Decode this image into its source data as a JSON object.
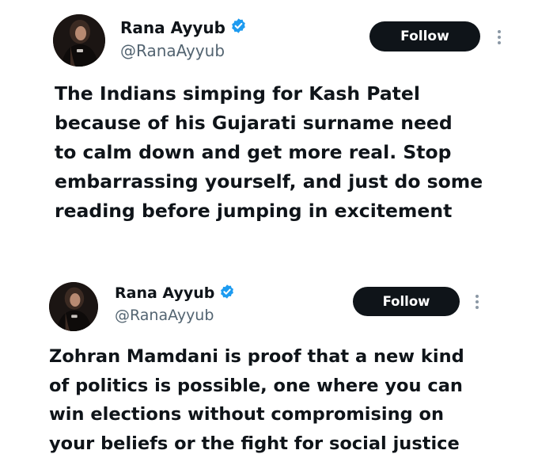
{
  "tweets": [
    {
      "author": {
        "name": "Rana Ayyub",
        "handle": "@RanaAyyub",
        "verified": true
      },
      "follow_label": "Follow",
      "text_lines": [
        "The Indians simping for Kash Patel",
        "because of his Gujarati surname need",
        "to calm down and get more real. Stop",
        "embarrassing yourself, and just do some",
        "reading before jumping in excitement"
      ]
    },
    {
      "author": {
        "name": "Rana Ayyub",
        "handle": "@RanaAyyub",
        "verified": true
      },
      "follow_label": "Follow",
      "text_lines": [
        "Zohran Mamdani is proof that a new kind",
        "of politics is possible, one where you can",
        "win elections without compromising on",
        "your beliefs or the fight for social justice"
      ]
    }
  ],
  "colors": {
    "text": "#0f1419",
    "secondary": "#536471",
    "verified_blue": "#1d9bf0",
    "follow_bg": "#0f1419",
    "follow_text": "#ffffff"
  },
  "icons": {
    "verified": "verified-badge-icon",
    "more": "more-options-icon",
    "avatar": "profile-photo"
  }
}
